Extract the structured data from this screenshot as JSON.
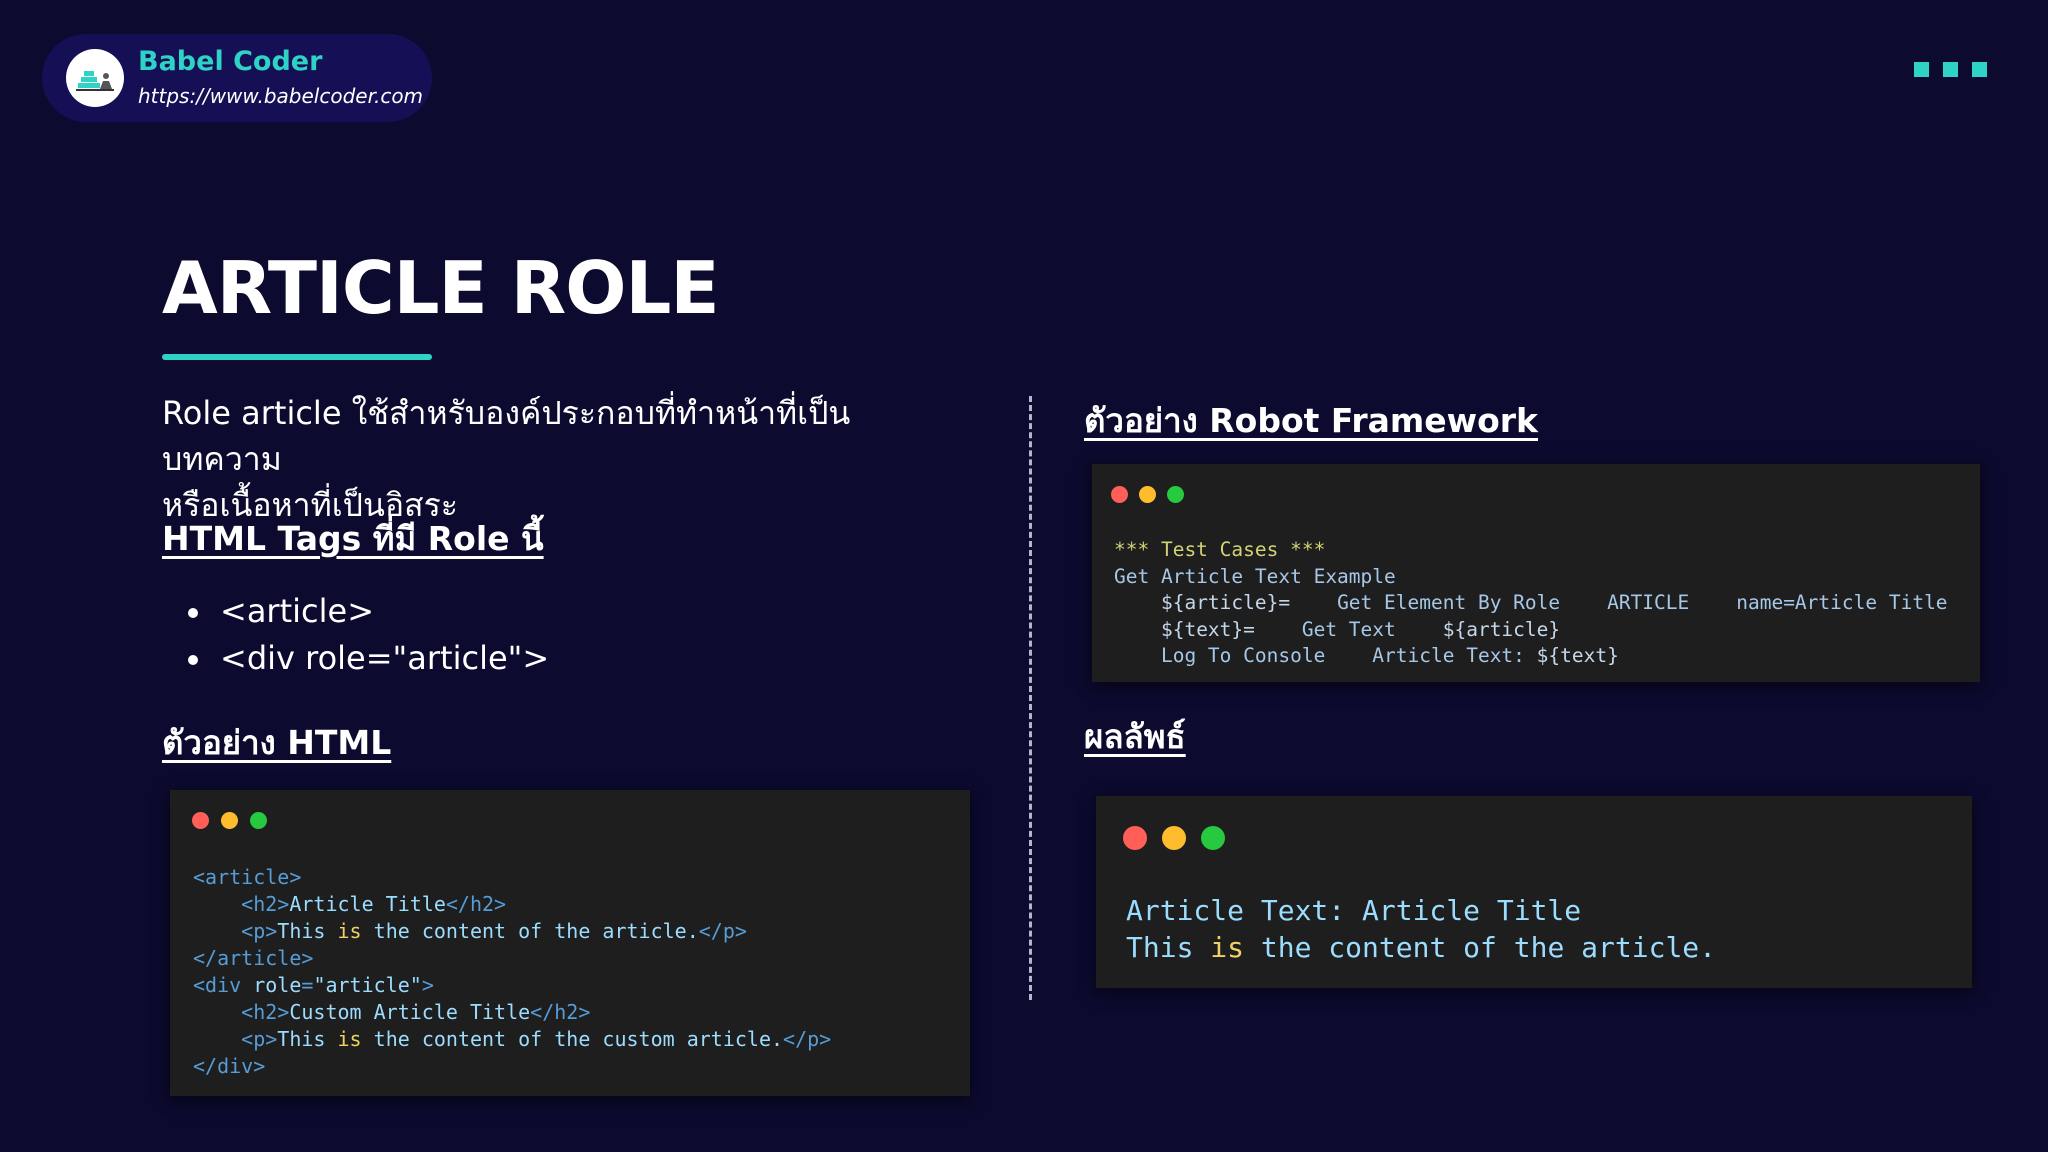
{
  "brand": {
    "name": "Babel Coder",
    "url": "https://www.babelcoder.com",
    "logo_icon": "babel-coder-logo"
  },
  "menu_icon": "three-squares-menu-icon",
  "slide": {
    "title": "ARTICLE ROLE",
    "description_line1": "Role article ใช้สำหรับองค์ประกอบที่ทำหน้าที่เป็นบทความ",
    "description_line2": "หรือเนื้อหาที่เป็นอิสระ",
    "tags_heading": "HTML Tags ที่มี Role นี้",
    "tags": [
      "<article>",
      "<div role=\"article\">"
    ],
    "html_example_heading": "ตัวอย่าง HTML",
    "robot_example_heading": "ตัวอย่าง Robot Framework",
    "result_heading": "ผลลัพธ์"
  },
  "html_code": {
    "lines": [
      [
        {
          "t": "<article>",
          "c": "tag"
        }
      ],
      [
        {
          "t": "    "
        },
        {
          "t": "<h2>",
          "c": "tag"
        },
        {
          "t": "Article Title",
          "c": "txt"
        },
        {
          "t": "</h2>",
          "c": "tag"
        }
      ],
      [
        {
          "t": "    "
        },
        {
          "t": "<p>",
          "c": "tag"
        },
        {
          "t": "This ",
          "c": "txt"
        },
        {
          "t": "is",
          "c": "kw"
        },
        {
          "t": " the content of the article.",
          "c": "txt"
        },
        {
          "t": "</p>",
          "c": "tag"
        }
      ],
      [
        {
          "t": "</article>",
          "c": "tag"
        }
      ],
      [
        {
          "t": "<div ",
          "c": "tag"
        },
        {
          "t": "role",
          "c": "attr"
        },
        {
          "t": "=",
          "c": "tag"
        },
        {
          "t": "\"article\"",
          "c": "txt"
        },
        {
          "t": ">",
          "c": "tag"
        }
      ],
      [
        {
          "t": "    "
        },
        {
          "t": "<h2>",
          "c": "tag"
        },
        {
          "t": "Custom Article Title",
          "c": "txt"
        },
        {
          "t": "</h2>",
          "c": "tag"
        }
      ],
      [
        {
          "t": "    "
        },
        {
          "t": "<p>",
          "c": "tag"
        },
        {
          "t": "This ",
          "c": "txt"
        },
        {
          "t": "is",
          "c": "kw"
        },
        {
          "t": " the content of the custom article.",
          "c": "txt"
        },
        {
          "t": "</p>",
          "c": "tag"
        }
      ],
      [
        {
          "t": "</div>",
          "c": "tag"
        }
      ]
    ]
  },
  "robot_code": {
    "lines": [
      [
        {
          "t": "*** Test Cases ***",
          "c": "sec"
        }
      ],
      [
        {
          "t": "Get Article Text Example",
          "c": "cm"
        }
      ],
      [
        {
          "t": "    "
        },
        {
          "t": "${article}=",
          "c": "var"
        },
        {
          "t": "    Get Element By Role    ARTICLE    name=Article Title",
          "c": "cm"
        }
      ],
      [
        {
          "t": "    "
        },
        {
          "t": "${text}=",
          "c": "var"
        },
        {
          "t": "    Get Text    ",
          "c": "cm"
        },
        {
          "t": "${article}",
          "c": "var"
        }
      ],
      [
        {
          "t": "    "
        },
        {
          "t": "Log To Console    Article Text: ",
          "c": "cm"
        },
        {
          "t": "${text}",
          "c": "var"
        }
      ]
    ]
  },
  "result_code": {
    "lines": [
      [
        {
          "t": "Article Text: Article Title",
          "c": "txt"
        }
      ],
      [
        {
          "t": "This ",
          "c": "txt"
        },
        {
          "t": "is",
          "c": "kw"
        },
        {
          "t": " the content of the article.",
          "c": "txt"
        }
      ]
    ]
  },
  "window_dot_colors": [
    "#ff5f56",
    "#ffbd2e",
    "#27c93f"
  ]
}
